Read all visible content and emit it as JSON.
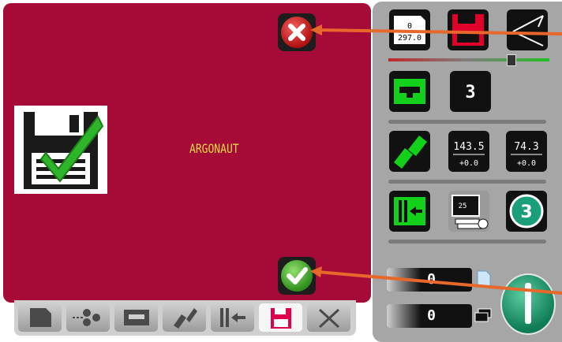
{
  "dialog": {
    "document_name": "ARGONAUT",
    "close_label": "Close",
    "confirm_label": "Confirm"
  },
  "tabs": [
    {
      "name": "tab-page",
      "icon": "page-icon"
    },
    {
      "name": "tab-rollers",
      "icon": "rollers-icon"
    },
    {
      "name": "tab-tray",
      "icon": "tray-icon"
    },
    {
      "name": "tab-cut",
      "icon": "cut-icon"
    },
    {
      "name": "tab-align",
      "icon": "align-icon"
    },
    {
      "name": "tab-save",
      "icon": "floppy-icon",
      "active": true
    },
    {
      "name": "tab-tools",
      "icon": "tools-icon"
    }
  ],
  "panel": {
    "sheet_size_top": "0",
    "sheet_size_bottom": "297.0",
    "count_a": "3",
    "x_value": "143.5",
    "x_offset": "+0.0",
    "y_value": "74.3",
    "y_offset": "+0.0",
    "monitor_value": "25",
    "badge_value": "3",
    "counter_1": "0",
    "counter_2": "0"
  },
  "colors": {
    "dialog_bg": "#a60b37",
    "panel_bg": "#a6a6a6",
    "accent_green": "#13d11b",
    "arrow": "#e8672a"
  }
}
